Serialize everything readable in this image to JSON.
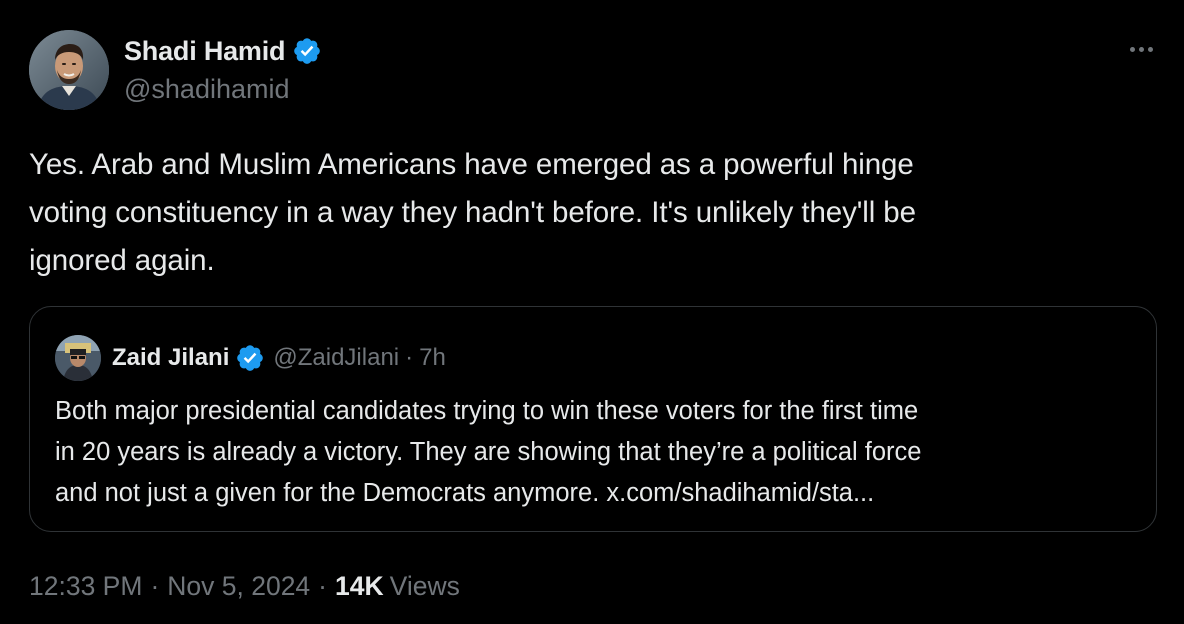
{
  "author": {
    "display_name": "Shadi Hamid",
    "handle": "@shadihamid",
    "verified_icon": "verified-badge-icon",
    "verified_color": "#1d9bf0"
  },
  "tweet": {
    "lines": [
      "Yes. Arab and Muslim Americans have emerged as a powerful hinge",
      "voting constituency in a way they hadn't before. It's unlikely they'll be",
      "ignored again."
    ]
  },
  "quoted": {
    "display_name": "Zaid Jilani",
    "handle": "@ZaidJilani",
    "separator": "·",
    "time": "7h",
    "lines": [
      "Both major presidential candidates trying to win these voters for the first time",
      "in 20 years is already a victory. They are showing that they’re a political force",
      "and not just a given for the Democrats anymore. x.com/shadihamid/sta..."
    ]
  },
  "meta": {
    "time": "12:33 PM",
    "separator": "·",
    "date": "Nov 5, 2024",
    "views_count": "14K",
    "views_label": "Views"
  },
  "colors": {
    "background": "#000000",
    "text_primary": "#e7e9ea",
    "text_secondary": "#71767b",
    "border": "#2f3336",
    "accent": "#1d9bf0"
  }
}
